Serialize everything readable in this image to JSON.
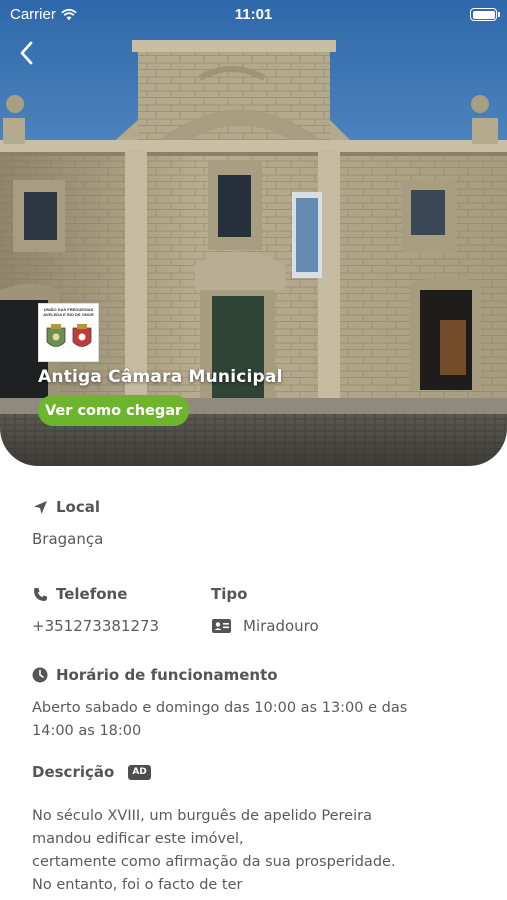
{
  "status_bar": {
    "carrier": "Carrier",
    "time": "11:01"
  },
  "place": {
    "title": "Antiga Câmara Municipal",
    "directions_label": "Ver como chegar",
    "logo_text": [
      "UNIÃO DAS FREGUESIAS",
      "AVELEDA E RIO DE ONOR"
    ]
  },
  "details": {
    "location_label": "Local",
    "location_value": "Bragança",
    "phone_label": "Telefone",
    "phone_value": "+351273381273",
    "type_label": "Tipo",
    "type_value": "Miradouro",
    "hours_label": "Horário de funcionamento",
    "hours_lines": [
      "Aberto sabado e domingo das 10:00 as 13:00 e das",
      "14:00 as 18:00"
    ],
    "description_label": "Descrição",
    "description_badge": "AD",
    "description_lines": [
      "No século XVIII, um burguês de apelido Pereira",
      "mandou edificar este imóvel,",
      "certamente como afirmação da sua prosperidade.",
      "No entanto, foi o facto de ter"
    ]
  },
  "colors": {
    "accent_green": "#6cb52c",
    "sky_blue": "#3f78b8",
    "stone": "#b5aa8e"
  },
  "icons": [
    "back-chevron-icon",
    "wifi-icon",
    "battery-icon",
    "location-arrow-icon",
    "phone-icon",
    "id-card-icon",
    "clock-icon"
  ]
}
